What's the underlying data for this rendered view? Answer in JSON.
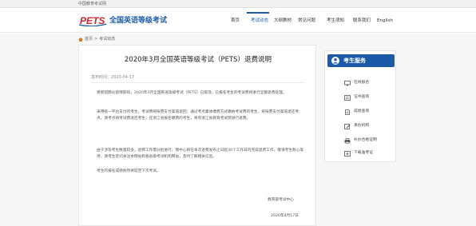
{
  "topbar": {
    "org": "中国教育考试网"
  },
  "header": {
    "logo_text": "PETS",
    "site_title": "全国英语等级考试",
    "nav": [
      "首页",
      "考试动态",
      "大纲教材",
      "常见问题",
      "考生须知",
      "联系我们",
      "English"
    ],
    "active_nav": "考试动态"
  },
  "breadcrumb": {
    "home": "首页",
    "sep": ">",
    "current": "考试动态"
  },
  "article": {
    "title": "2020年3月全国英语等级考试（PETS）退费说明",
    "date_label": "发布时间：",
    "date": "2020-04-17",
    "paragraphs": [
      "受新冠肺炎疫情影响，2020年3月全国英语等级考试（PETS）已取消，已报名考生的考试费将进行全额退费处理。",
      "采用统一平台支付的考生，考试费将按原支付渠道退回；通过考点集体缴费方式缴纳考试费的考生，将按原支付渠道退还考点，请考点将考试费退还考生；在浙江省报名缴费的考生，将有浙江省教育考试院进行退费。",
      "由于涉及考生数量较多，退费工作需分批进行，我中心将在本次退费发布之日起30个工作日内完成退费工作。敬请考生耐心等待，请考生密切关注本网站和各省级考试机构网站，及时了解相关信息。",
      "考生的报名成绩依然将延至下次考试。"
    ],
    "signature_org": "教育部考试中心",
    "signature_date": "2020年4月17日"
  },
  "sidebar": {
    "title": "考生服务",
    "items": [
      {
        "label": "在线报名",
        "icon": "monitor-icon"
      },
      {
        "label": "证书查询",
        "icon": "certificate-icon"
      },
      {
        "label": "成绩查询",
        "icon": "document-icon"
      },
      {
        "label": "承办机构",
        "icon": "edit-icon"
      },
      {
        "label": "补办合格证明",
        "icon": "print-icon"
      },
      {
        "label": "下载准考证",
        "icon": "download-icon"
      }
    ]
  },
  "colors": {
    "brand_blue": "#1a5aa8",
    "logo_red": "#d7262b"
  }
}
